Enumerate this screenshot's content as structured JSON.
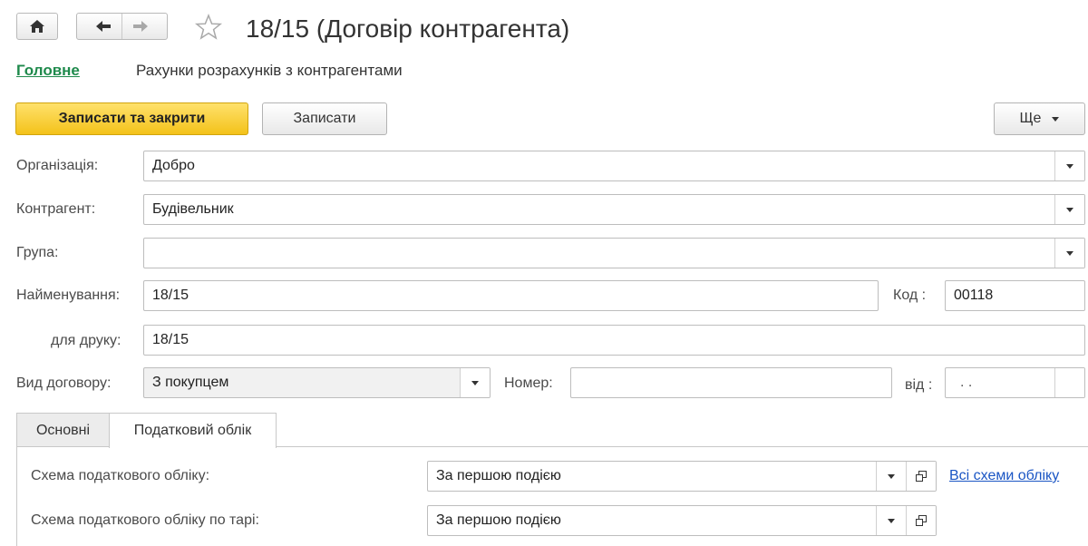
{
  "window": {
    "title": "18/15 (Договір контрагента)"
  },
  "nav": {
    "main_link": "Головне",
    "sub_link": "Рахунки розрахунків з контрагентами"
  },
  "toolbar": {
    "save_close_label": "Записати та закрити",
    "save_label": "Записати",
    "more_label": "Ще"
  },
  "form": {
    "organization": {
      "label": "Організація:",
      "value": "Добро"
    },
    "counterparty": {
      "label": "Контрагент:",
      "value": "Будівельник"
    },
    "group": {
      "label": "Група:",
      "value": ""
    },
    "name": {
      "label": "Найменування:",
      "value": "18/15"
    },
    "code": {
      "label": "Код :",
      "value": "00118"
    },
    "print_name": {
      "label": "для друку:",
      "value": "18/15"
    },
    "contract_type": {
      "label": "Вид договору:",
      "value": "З покупцем"
    },
    "number": {
      "label": "Номер:",
      "value": ""
    },
    "date": {
      "label": "від :",
      "value": ". ."
    }
  },
  "tabs": [
    {
      "label": "Основні",
      "active": false
    },
    {
      "label": "Податковий облік",
      "active": true
    }
  ],
  "tax": {
    "scheme": {
      "label": "Схема податкового обліку:",
      "value": "За першою подією"
    },
    "scheme_tare": {
      "label": "Схема податкового обліку по тарі:",
      "value": "За першою подією"
    },
    "all_schemes_link": "Всі схеми обліку"
  },
  "colors": {
    "primary_button": "#f3c21a",
    "nav_link": "#1f8a4c",
    "blue_link": "#1a55c4"
  },
  "icons": {
    "home": "home-icon",
    "back": "arrow-left-icon",
    "forward": "arrow-right-icon",
    "favorite": "star-outline-icon",
    "dropdown": "chevron-down-icon",
    "open": "open-window-icon"
  }
}
